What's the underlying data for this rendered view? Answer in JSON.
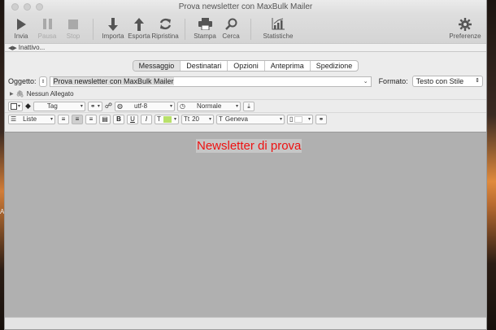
{
  "window": {
    "title": "Prova newsletter con MaxBulk Mailer"
  },
  "toolbar": {
    "send": "Invia",
    "pause": "Pausa",
    "stop": "Stop",
    "import": "Importa",
    "export": "Esporta",
    "restore": "Ripristina",
    "print": "Stampa",
    "search": "Cerca",
    "stats": "Statistiche",
    "prefs": "Preferenze"
  },
  "status": {
    "text": "Inattivo..."
  },
  "tabs": [
    "Messaggio",
    "Destinatari",
    "Opzioni",
    "Anteprima",
    "Spedizione"
  ],
  "subject": {
    "label": "Oggetto:",
    "value": "Prova newsletter con MaxBulk Mailer"
  },
  "format": {
    "label": "Formato:",
    "value": "Testo con Stile"
  },
  "attachment": {
    "label": "Nessun Allegato"
  },
  "tools1": {
    "tag": "Tag",
    "encoding": "utf-8",
    "priority": "Normale"
  },
  "tools2": {
    "lists": "Liste",
    "bold": "B",
    "underline": "U",
    "italic": "I",
    "text_t": "T",
    "size": "20",
    "font": "Geneva"
  },
  "editor": {
    "heading": "Newsletter di prova"
  },
  "desktop": {
    "letter": "A"
  },
  "colors": {
    "heading": "#ee1111",
    "editor_bg": "#b0b0b0",
    "text_color_swatch": "#b8e06a"
  }
}
